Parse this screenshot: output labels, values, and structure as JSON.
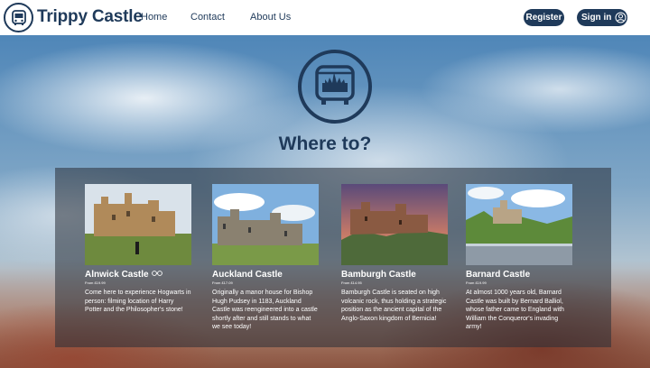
{
  "nav": {
    "brand": "Trippy Castle",
    "links": [
      "Home",
      "Contact",
      "About Us"
    ],
    "register": "Register",
    "signin": "Sign in"
  },
  "hero": {
    "title": "Where to?"
  },
  "cards": [
    {
      "name": "Alnwick Castle",
      "price": "From £19.99",
      "desc": "Come here to experience Hogwarts in person: filming location of Harry Potter and the Philosopher's stone!"
    },
    {
      "name": "Auckland Castle",
      "price": "From £17.09",
      "desc": "Originally a manor house for Bishop Hugh Pudsey in 1183, Auckland Castle was reengineered into a castle shortly after and still stands to what we see today!"
    },
    {
      "name": "Bamburgh Castle",
      "price": "From £14.95",
      "desc": "Bamburgh Castle is seated on high volcanic rock, thus holding a strategic position as the ancient capital of the Anglo-Saxon kingdom of Bernicia!"
    },
    {
      "name": "Barnard Castle",
      "price": "From £19.99",
      "desc": "At almost 1000 years old, Barnard Castle was built by Bernard Balliol, whose father came to England with William the Conqueror's invading army!"
    }
  ],
  "colors": {
    "navy": "#1f3a5a",
    "panel": "rgba(40,45,55,0.55)"
  }
}
